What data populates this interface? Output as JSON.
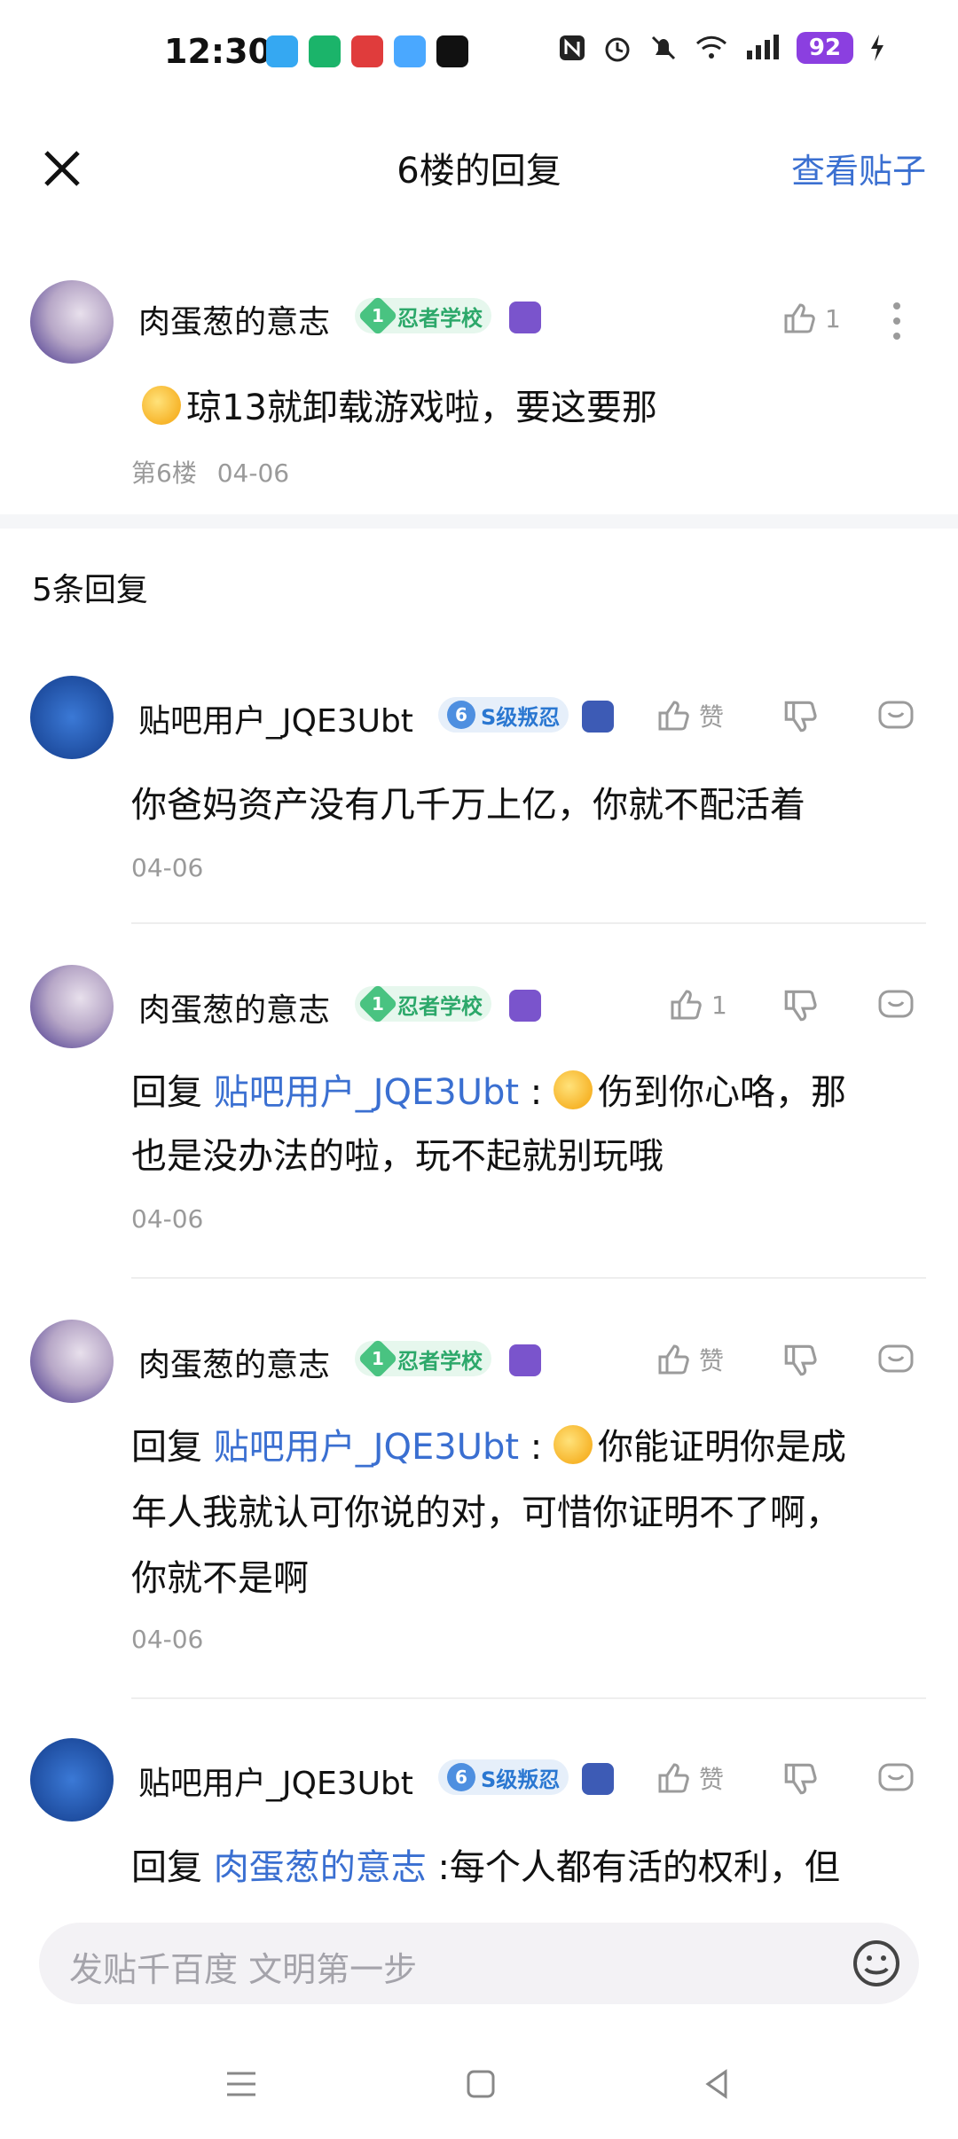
{
  "status": {
    "time": "12:30",
    "battery": "92",
    "apps": [
      "飞书",
      "安全",
      "起点",
      "QQ浏览器",
      "得物"
    ]
  },
  "header": {
    "title": "6楼的回复",
    "view_post": "查看贴子"
  },
  "main_post": {
    "user": "肉蛋葱的意志",
    "badge_level": "1",
    "badge_text": "忍者学校",
    "like_count": "1",
    "content": "琼13就卸载游戏啦，要这要那",
    "floor": "第6楼",
    "date": "04-06"
  },
  "replies_header": "5条回复",
  "replies": [
    {
      "user": "贴吧用户_JQE3Ubt",
      "badge_level": "6",
      "badge_text": "S级叛忍",
      "like_label": "赞",
      "content": "你爸妈资产没有几千万上亿，你就不配活着",
      "date": "04-06"
    },
    {
      "user": "肉蛋葱的意志",
      "badge_level": "1",
      "badge_text": "忍者学校",
      "like_label": "1",
      "reply_prefix": "回复",
      "reply_to": "贴吧用户_JQE3Ubt",
      "content_line1": "伤到你心咯，那",
      "content_line2": "也是没办法的啦，玩不起就别玩哦",
      "date": "04-06"
    },
    {
      "user": "肉蛋葱的意志",
      "badge_level": "1",
      "badge_text": "忍者学校",
      "like_label": "赞",
      "reply_prefix": "回复",
      "reply_to": "贴吧用户_JQE3Ubt",
      "content_line1": "你能证明你是成",
      "content_line2": "年人我就认可你说的对，可惜你证明不了啊，",
      "content_line3": "你就不是啊",
      "date": "04-06"
    },
    {
      "user": "贴吧用户_JQE3Ubt",
      "badge_level": "6",
      "badge_text": "S级叛忍",
      "like_label": "赞",
      "reply_prefix": "回复",
      "reply_to": "肉蛋葱的意志",
      "content_line1": ":每个人都有活的权利，但"
    }
  ],
  "input": {
    "placeholder": "发贴千百度 文明第一步"
  }
}
